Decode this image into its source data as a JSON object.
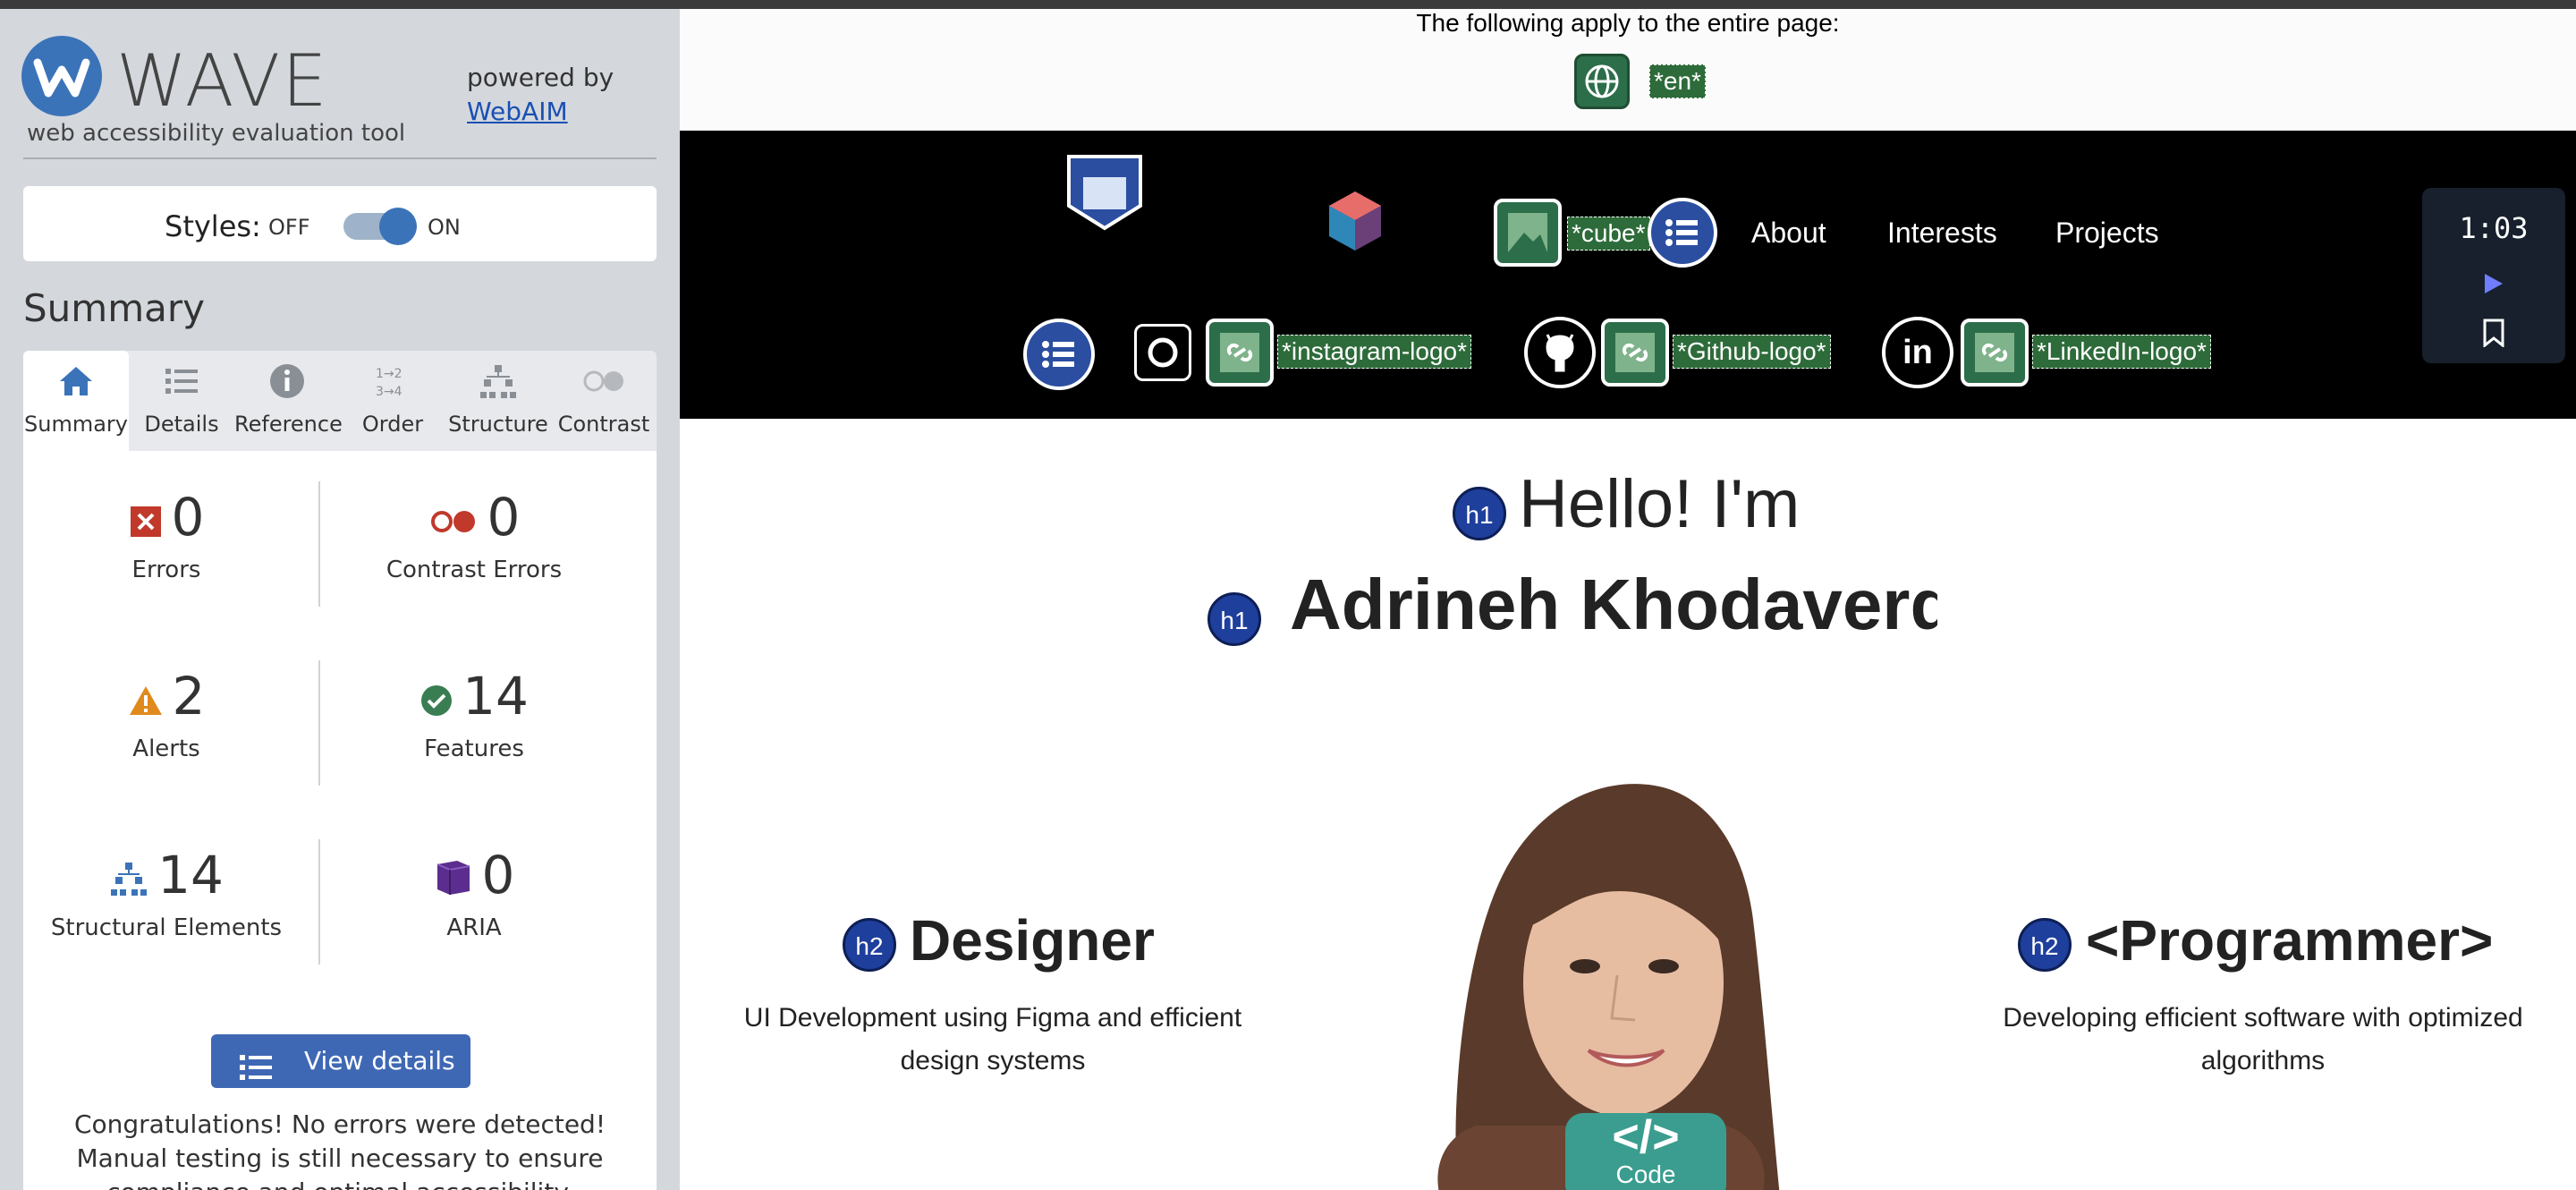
{
  "wave": {
    "logo_word": "WAVE",
    "tagline": "web accessibility evaluation tool",
    "powered_by": "powered by",
    "webaim_link": "WebAIM",
    "styles_label": "Styles:",
    "styles_off": "OFF",
    "styles_on": "ON",
    "summary_title": "Summary",
    "tabs": [
      {
        "label": "Summary",
        "icon": "home-icon"
      },
      {
        "label": "Details",
        "icon": "list-icon"
      },
      {
        "label": "Reference",
        "icon": "info-icon"
      },
      {
        "label": "Order",
        "icon": "order-icon"
      },
      {
        "label": "Structure",
        "icon": "hierarchy-icon"
      },
      {
        "label": "Contrast",
        "icon": "contrast-icon"
      }
    ],
    "stats": {
      "errors": {
        "value": "0",
        "label": "Errors"
      },
      "contrast_errors": {
        "value": "0",
        "label": "Contrast Errors"
      },
      "alerts": {
        "value": "2",
        "label": "Alerts"
      },
      "features": {
        "value": "14",
        "label": "Features"
      },
      "structural": {
        "value": "14",
        "label": "Structural Elements"
      },
      "aria": {
        "value": "0",
        "label": "ARIA"
      }
    },
    "view_details": "View details ›",
    "congrats": "Congratulations! No errors were detected! Manual testing is still necessary to ensure compliance and optimal accessibility."
  },
  "page": {
    "entire_page_note": "The following apply to the entire page:",
    "lang_label": "*en*",
    "cube_label": "*cube*",
    "nav": [
      "About",
      "Interests",
      "Projects"
    ],
    "instagram_label": "*instagram-logo*",
    "github_label": "*Github-logo*",
    "linkedin_label": "*LinkedIn-logo*",
    "timer": "1:03",
    "h1_badge": "h1",
    "h2_badge": "h2",
    "hello": "Hello! I'm",
    "name": "Adrineh Khodaverdi",
    "designer_title": "Designer",
    "designer_desc": "UI Development using Figma and efficient design systems",
    "programmer_title": "<Programmer>",
    "programmer_desc": "Developing efficient software with optimized algorithms",
    "code_badge_symbol": "</>",
    "code_badge_label": "Code"
  },
  "colors": {
    "wave_blue": "#3b73b9",
    "feature_green": "#2e6b3a",
    "error_red": "#c0392b",
    "alert_orange": "#e08a1e",
    "aria_purple": "#5b2d8e"
  }
}
